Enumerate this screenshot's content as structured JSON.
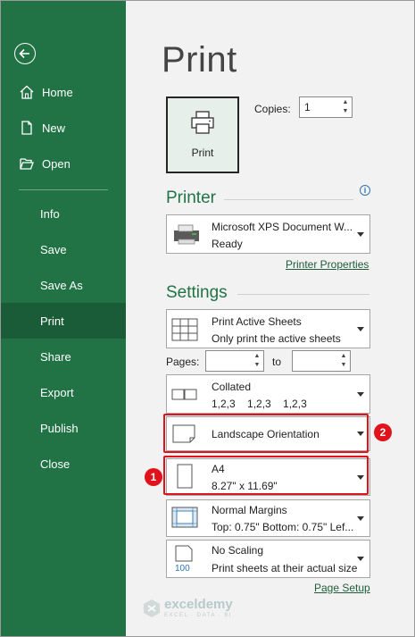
{
  "sidebar": {
    "items": [
      {
        "label": "Home",
        "icon": "home-icon"
      },
      {
        "label": "New",
        "icon": "new-doc-icon"
      },
      {
        "label": "Open",
        "icon": "folder-open-icon"
      },
      {
        "label": "Info"
      },
      {
        "label": "Save"
      },
      {
        "label": "Save As"
      },
      {
        "label": "Print",
        "active": true
      },
      {
        "label": "Share"
      },
      {
        "label": "Export"
      },
      {
        "label": "Publish"
      },
      {
        "label": "Close"
      }
    ],
    "color": "#217346",
    "active_color": "#1a5c38"
  },
  "main": {
    "title": "Print",
    "print_button_label": "Print",
    "copies_label": "Copies:",
    "copies_value": "1",
    "printer": {
      "heading": "Printer",
      "name": "Microsoft XPS Document W...",
      "status": "Ready",
      "properties_link": "Printer Properties"
    },
    "settings": {
      "heading": "Settings",
      "print_what": {
        "line1": "Print Active Sheets",
        "line2": "Only print the active sheets"
      },
      "pages_label": "Pages:",
      "to_label": "to",
      "collation": {
        "line1": "Collated",
        "line2": "1,2,3    1,2,3    1,2,3"
      },
      "orientation": "Landscape Orientation",
      "paper": {
        "line1": "A4",
        "line2": "8.27\" x 11.69\""
      },
      "margins": {
        "line1": "Normal Margins",
        "line2": "Top: 0.75\" Bottom: 0.75\" Lef..."
      },
      "scaling": {
        "line1": "No Scaling",
        "line2": "Print sheets at their actual size",
        "icon_text": "100"
      },
      "page_setup_link": "Page Setup"
    },
    "annotations": {
      "badge1": "1",
      "badge2": "2",
      "highlight_color": "#e0121b"
    }
  },
  "watermark": {
    "name": "exceldemy",
    "tagline": "EXCEL · DATA · BI"
  }
}
